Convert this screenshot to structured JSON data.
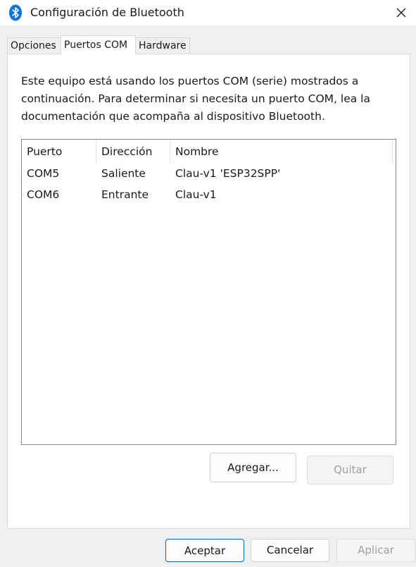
{
  "window": {
    "title": "Configuración de Bluetooth"
  },
  "tabs": [
    {
      "label": "Opciones"
    },
    {
      "label": "Puertos COM",
      "selected": true
    },
    {
      "label": "Hardware"
    }
  ],
  "content": {
    "description": "Este equipo está usando los puertos COM (serie) mostrados a continuación. Para determinar si necesita un puerto COM, lea la documentación que acompaña al dispositivo Bluetooth."
  },
  "ports_table": {
    "headers": [
      "Puerto",
      "Dirección",
      "Nombre"
    ],
    "rows": [
      [
        "COM5",
        "Saliente",
        "Clau-v1 'ESP32SPP'"
      ],
      [
        "COM6",
        "Entrante",
        "Clau-v1"
      ]
    ]
  },
  "actions": {
    "add_label": "Agregar...",
    "remove_label": "Quitar"
  },
  "footer": {
    "ok_label": "Aceptar",
    "cancel_label": "Cancelar",
    "apply_label": "Aplicar"
  },
  "colors": {
    "accent": "#0067c0",
    "bluetooth_icon": "#0a74da"
  }
}
